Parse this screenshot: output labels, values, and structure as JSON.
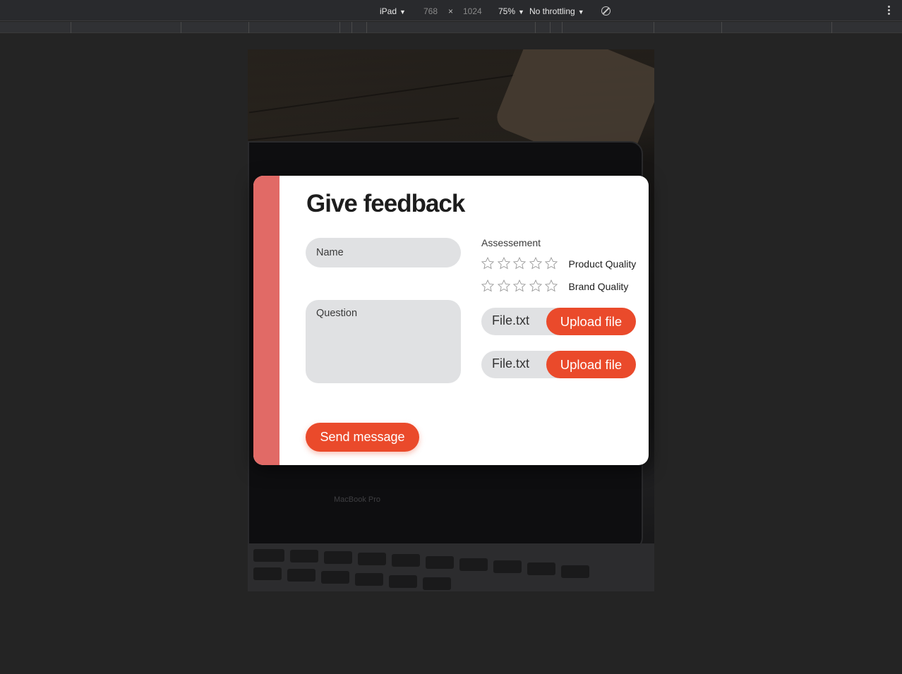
{
  "devtools": {
    "device": "iPad",
    "width": "768",
    "separator": "×",
    "height": "1024",
    "zoom": "75%",
    "throttling": "No throttling"
  },
  "background": {
    "laptop_label": "MacBook Pro"
  },
  "form": {
    "title": "Give feedback",
    "name_placeholder": "Name",
    "question_placeholder": "Question",
    "assessment_label": "Assessement",
    "ratings": [
      {
        "label": "Product Quality",
        "value": 0,
        "max": 5
      },
      {
        "label": "Brand Quality",
        "value": 0,
        "max": 5
      }
    ],
    "uploads": [
      {
        "file_name": "File.txt",
        "button_label": "Upload file"
      },
      {
        "file_name": "File.txt",
        "button_label": "Upload file"
      }
    ],
    "send_label": "Send message"
  },
  "colors": {
    "accent": "#ea4a2b",
    "side_bar": "#e16a66",
    "field_bg": "#e0e1e3"
  }
}
